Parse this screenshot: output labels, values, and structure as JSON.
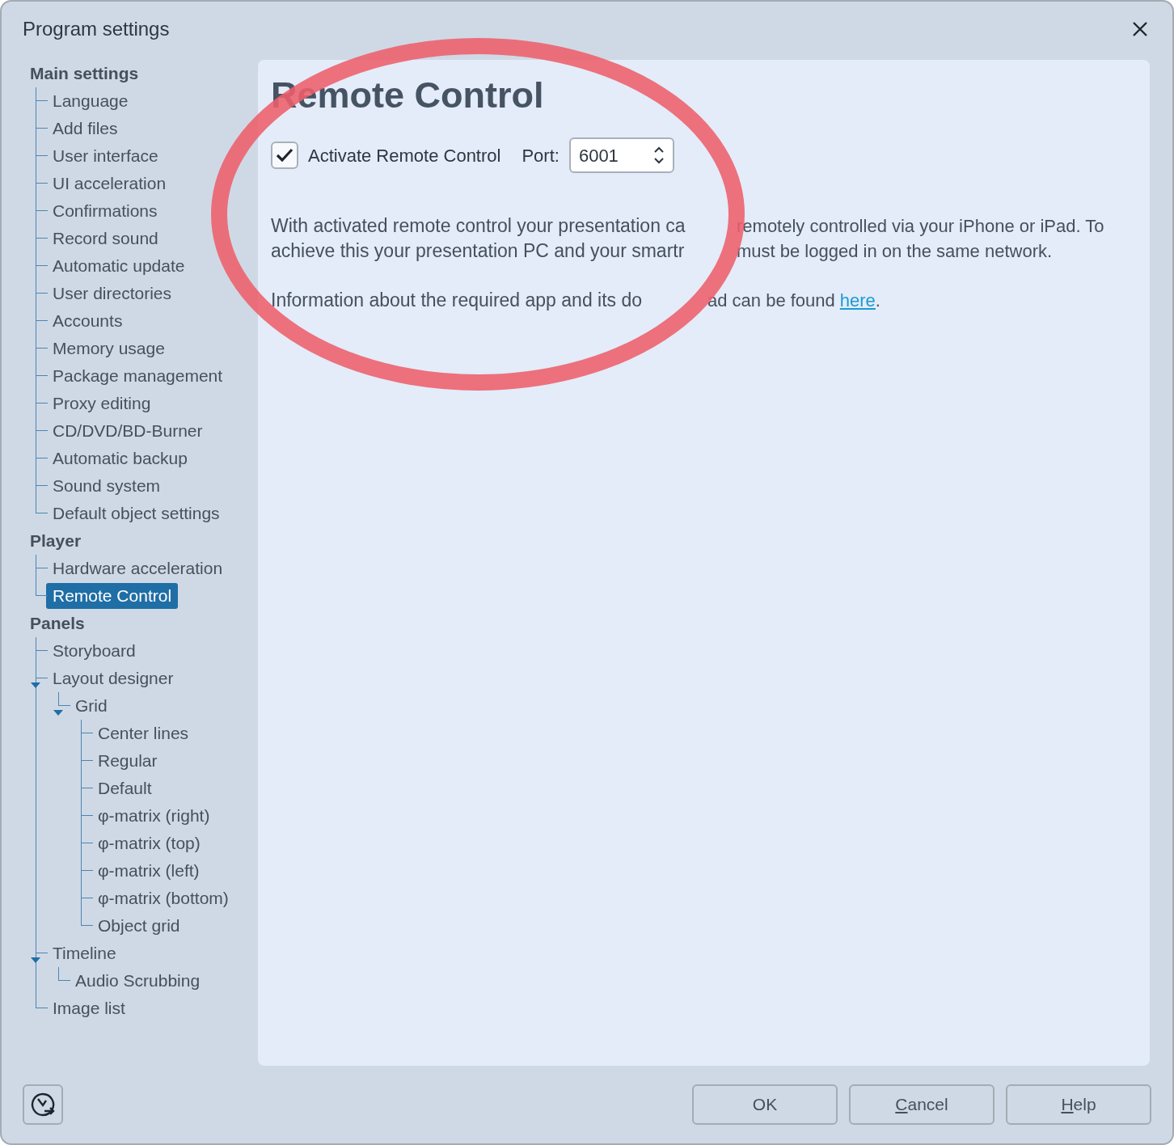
{
  "window": {
    "title": "Program settings"
  },
  "sidebar": {
    "groups": [
      {
        "label": "Main settings",
        "selected": false,
        "children": [
          {
            "label": "Language",
            "selected": false
          },
          {
            "label": "Add files",
            "selected": false
          },
          {
            "label": "User interface",
            "selected": false
          },
          {
            "label": "UI acceleration",
            "selected": false
          },
          {
            "label": "Confirmations",
            "selected": false
          },
          {
            "label": "Record sound",
            "selected": false
          },
          {
            "label": "Automatic update",
            "selected": false
          },
          {
            "label": "User directories",
            "selected": false
          },
          {
            "label": "Accounts",
            "selected": false
          },
          {
            "label": "Memory usage",
            "selected": false
          },
          {
            "label": "Package management",
            "selected": false
          },
          {
            "label": "Proxy editing",
            "selected": false
          },
          {
            "label": "CD/DVD/BD-Burner",
            "selected": false
          },
          {
            "label": "Automatic backup",
            "selected": false
          },
          {
            "label": "Sound system",
            "selected": false
          },
          {
            "label": "Default object settings",
            "selected": false
          }
        ]
      },
      {
        "label": "Player",
        "selected": false,
        "children": [
          {
            "label": "Hardware acceleration",
            "selected": false
          },
          {
            "label": "Remote Control",
            "selected": true
          }
        ]
      },
      {
        "label": "Panels",
        "selected": false,
        "children": [
          {
            "label": "Storyboard",
            "selected": false
          },
          {
            "label": "Layout designer",
            "selected": false,
            "expanded": true,
            "children": [
              {
                "label": "Grid",
                "selected": false,
                "expanded": true,
                "children": [
                  {
                    "label": "Center lines",
                    "selected": false
                  },
                  {
                    "label": "Regular",
                    "selected": false
                  },
                  {
                    "label": "Default",
                    "selected": false
                  },
                  {
                    "label": "φ-matrix (right)",
                    "selected": false
                  },
                  {
                    "label": "φ-matrix (top)",
                    "selected": false
                  },
                  {
                    "label": "φ-matrix (left)",
                    "selected": false
                  },
                  {
                    "label": "φ-matrix (bottom)",
                    "selected": false
                  },
                  {
                    "label": "Object grid",
                    "selected": false
                  }
                ]
              }
            ]
          },
          {
            "label": "Timeline",
            "selected": false,
            "expanded": true,
            "children": [
              {
                "label": "Audio Scrubbing",
                "selected": false
              }
            ]
          },
          {
            "label": "Image list",
            "selected": false
          }
        ]
      }
    ]
  },
  "content": {
    "heading": "Remote Control",
    "activate": {
      "label": "Activate Remote Control",
      "checked": true
    },
    "port": {
      "label": "Port:",
      "value": "6001"
    },
    "description_lines": [
      {
        "magnified": "With activated remote control your presentation ca",
        "plain": "remotely controlled via your iPhone or iPad. To"
      },
      {
        "magnified": "achieve this your presentation PC and your smartr",
        "plain": "must be logged in on the same network."
      }
    ],
    "info_line": {
      "magnified": "Information about the required app and its do",
      "plain": "ad can be found",
      "link": "here",
      "tail": "."
    }
  },
  "buttons": [
    {
      "label": "OK",
      "mnemonic_underlined": false
    },
    {
      "label": "Cancel",
      "mnemonic_underlined": true
    },
    {
      "label": "Help",
      "mnemonic_underlined": true
    }
  ],
  "annotation": {
    "kind": "ellipse"
  }
}
